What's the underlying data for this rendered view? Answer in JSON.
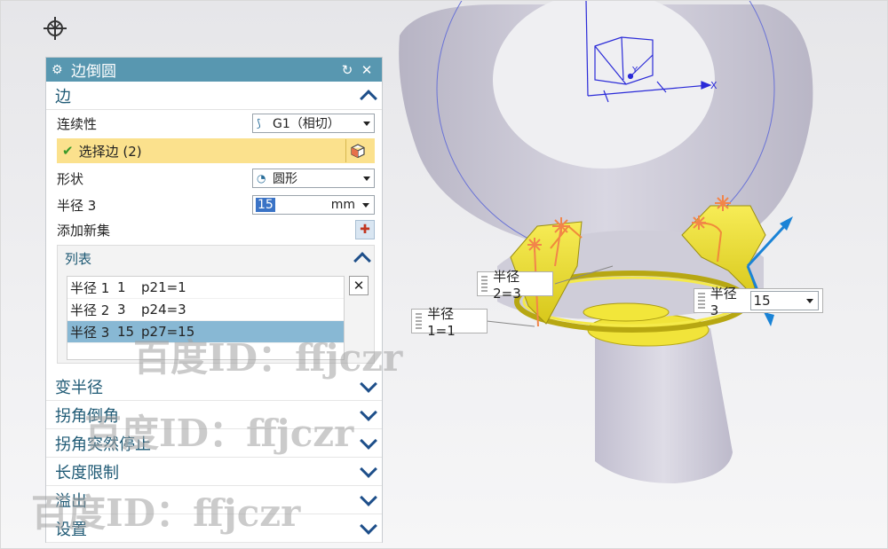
{
  "dialog": {
    "title": "边倒圆",
    "sections": {
      "edge": {
        "label": "边",
        "continuity_label": "连续性",
        "continuity_value": "G1（相切）",
        "select_edge_label": "选择边 (2)",
        "shape_label": "形状",
        "shape_value": "圆形",
        "radius_label": "半径 3",
        "radius_value": "15",
        "radius_unit": "mm",
        "add_set_label": "添加新集"
      },
      "list": {
        "label": "列表",
        "rows": [
          {
            "name": "半径 1",
            "value": "1",
            "expr": "p21=1",
            "selected": false
          },
          {
            "name": "半径 2",
            "value": "3",
            "expr": "p24=3",
            "selected": false
          },
          {
            "name": "半径 3",
            "value": "15",
            "expr": "p27=15",
            "selected": true
          }
        ]
      },
      "collapsed": [
        {
          "label": "变半径"
        },
        {
          "label": "拐角倒角"
        },
        {
          "label": "拐角突然停止"
        },
        {
          "label": "长度限制"
        },
        {
          "label": "溢出"
        },
        {
          "label": "设置"
        }
      ]
    }
  },
  "viewport": {
    "axis_x_label": "X",
    "axis_y_label": "Y",
    "callouts": {
      "r2": "半径 2=3",
      "r1": "半径 1=1",
      "r3_label": "半径 3",
      "r3_value": "15"
    }
  },
  "watermark": "百度ID：ffjczr",
  "colors": {
    "titlebar": "#5897b0",
    "model": "#c9c7d4",
    "fillet": "#f2e42a",
    "selection": "#88b8d4",
    "accent": "#1e4f8a"
  }
}
